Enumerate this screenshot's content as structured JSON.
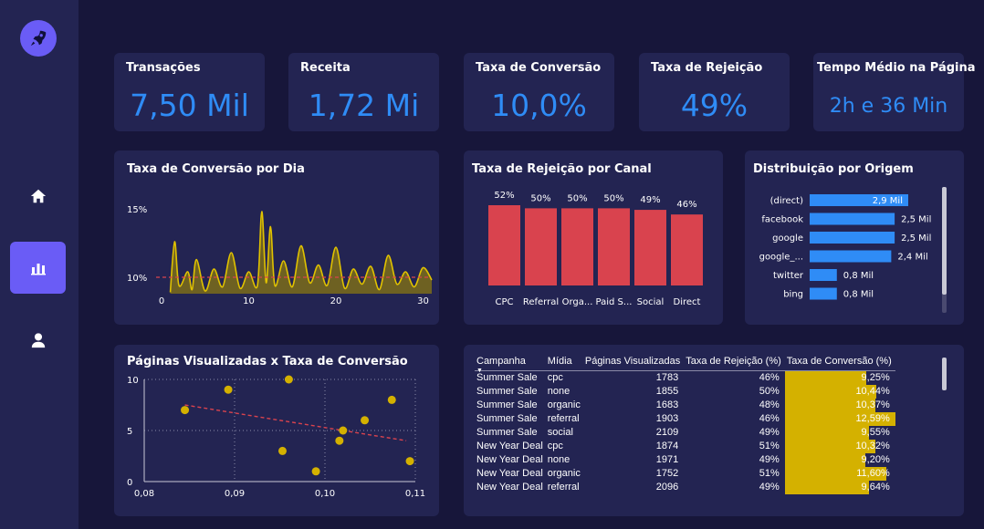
{
  "colors": {
    "accent": "#2f8cf6",
    "bar_red": "#d9434e",
    "gold": "#d4b100",
    "sidebar_active": "#6a5cf6"
  },
  "sidebar": {
    "logo_icon": "rocket-icon",
    "items": [
      {
        "icon": "home-icon",
        "active": false
      },
      {
        "icon": "bar-chart-icon",
        "active": true
      },
      {
        "icon": "user-icon",
        "active": false
      }
    ]
  },
  "kpis": [
    {
      "title": "Transações",
      "value": "7,50 Mil"
    },
    {
      "title": "Receita",
      "value": "1,72 Mi"
    },
    {
      "title": "Taxa de Conversão",
      "value": "10,0%"
    },
    {
      "title": "Taxa de Rejeição",
      "value": "49%"
    },
    {
      "title": "Tempo Médio na Página",
      "value": "2h e 36 Min"
    }
  ],
  "area_chart": {
    "title": "Taxa de Conversão por Dia",
    "chart_data": {
      "type": "area",
      "x_ticks": [
        "0",
        "10",
        "20",
        "30"
      ],
      "y_ticks": [
        "15%",
        "10%"
      ],
      "xlim": [
        0,
        31
      ],
      "ylim": [
        8.8,
        15.6
      ],
      "reference_line": 10,
      "x": [
        1,
        1.5,
        2,
        3,
        3.5,
        4,
        5,
        6,
        7,
        8,
        9,
        10,
        11,
        11.5,
        12,
        12.5,
        13,
        14,
        15,
        16,
        17,
        18,
        19,
        20,
        21,
        22,
        23,
        24,
        25,
        26,
        27,
        28,
        29,
        30,
        31
      ],
      "values": [
        8.9,
        12.6,
        9.4,
        10.4,
        9.1,
        11.3,
        9.0,
        10.6,
        9.3,
        11.8,
        9.2,
        10.4,
        9.4,
        14.8,
        9.6,
        13.7,
        9.4,
        11.2,
        9.3,
        12.3,
        9.6,
        10.9,
        9.4,
        12.2,
        9.2,
        10.6,
        9.5,
        10.8,
        9.1,
        11.6,
        9.5,
        10.4,
        9.3,
        10.7,
        9.8
      ]
    }
  },
  "bar_chart": {
    "title": "Taxa de Rejeição por Canal",
    "chart_data": {
      "type": "bar",
      "categories": [
        "CPC",
        "Referral",
        "Orga...",
        "Paid S...",
        "Social",
        "Direct"
      ],
      "values": [
        52,
        50,
        50,
        50,
        49,
        46
      ],
      "labels": [
        "52%",
        "50%",
        "50%",
        "50%",
        "49%",
        "46%"
      ],
      "ylim": [
        0,
        52
      ]
    }
  },
  "hbar_chart": {
    "title": "Distribuição por Origem",
    "chart_data": {
      "type": "bar",
      "orientation": "horizontal",
      "categories": [
        "(direct)",
        "facebook",
        "google",
        "google_...",
        "twitter",
        "bing"
      ],
      "values": [
        2.9,
        2.5,
        2.5,
        2.4,
        0.8,
        0.8
      ],
      "labels": [
        "2,9 Mil",
        "2,5 Mil",
        "2,5 Mil",
        "2,4 Mil",
        "0,8 Mil",
        "0,8 Mil"
      ],
      "xlim": [
        0,
        2.9
      ]
    }
  },
  "scatter_chart": {
    "title": "Páginas Visualizadas x Taxa de Conversão",
    "chart_data": {
      "type": "scatter",
      "x_ticks": [
        "0,08",
        "0,09",
        "0,10",
        "0,11"
      ],
      "y_ticks": [
        "10",
        "5",
        "0"
      ],
      "xlim": [
        0.08,
        0.11
      ],
      "ylim": [
        0,
        10
      ],
      "points": [
        {
          "x": 0.0845,
          "y": 7
        },
        {
          "x": 0.0893,
          "y": 9
        },
        {
          "x": 0.0953,
          "y": 3
        },
        {
          "x": 0.096,
          "y": 10
        },
        {
          "x": 0.099,
          "y": 1
        },
        {
          "x": 0.1016,
          "y": 4
        },
        {
          "x": 0.102,
          "y": 5
        },
        {
          "x": 0.1044,
          "y": 6
        },
        {
          "x": 0.1074,
          "y": 8
        },
        {
          "x": 0.1094,
          "y": 2
        }
      ],
      "trend": {
        "x": [
          0.0845,
          0.109
        ],
        "y": [
          7.5,
          4.0
        ]
      }
    }
  },
  "table": {
    "headers": [
      "Campanha",
      "Mídia",
      "Páginas Visualizadas",
      "Taxa de Rejeição (%)",
      "Taxa de Conversão (%)"
    ],
    "rows": [
      {
        "campanha": "Summer Sale",
        "midia": "cpc",
        "paginas": "1783",
        "rejeicao": "46%",
        "conversao": "9,25%",
        "conv_value": 9.25
      },
      {
        "campanha": "Summer Sale",
        "midia": "none",
        "paginas": "1855",
        "rejeicao": "50%",
        "conversao": "10,44%",
        "conv_value": 10.44
      },
      {
        "campanha": "Summer Sale",
        "midia": "organic",
        "paginas": "1683",
        "rejeicao": "48%",
        "conversao": "10,37%",
        "conv_value": 10.37
      },
      {
        "campanha": "Summer Sale",
        "midia": "referral",
        "paginas": "1903",
        "rejeicao": "46%",
        "conversao": "12,59%",
        "conv_value": 12.59
      },
      {
        "campanha": "Summer Sale",
        "midia": "social",
        "paginas": "2109",
        "rejeicao": "49%",
        "conversao": "9,55%",
        "conv_value": 9.55
      },
      {
        "campanha": "New Year Deal",
        "midia": "cpc",
        "paginas": "1874",
        "rejeicao": "51%",
        "conversao": "10,32%",
        "conv_value": 10.32
      },
      {
        "campanha": "New Year Deal",
        "midia": "none",
        "paginas": "1971",
        "rejeicao": "49%",
        "conversao": "9,20%",
        "conv_value": 9.2
      },
      {
        "campanha": "New Year Deal",
        "midia": "organic",
        "paginas": "1752",
        "rejeicao": "51%",
        "conversao": "11,60%",
        "conv_value": 11.6
      },
      {
        "campanha": "New Year Deal",
        "midia": "referral",
        "paginas": "2096",
        "rejeicao": "49%",
        "conversao": "9,64%",
        "conv_value": 9.64
      }
    ],
    "conv_max": 12.59
  }
}
